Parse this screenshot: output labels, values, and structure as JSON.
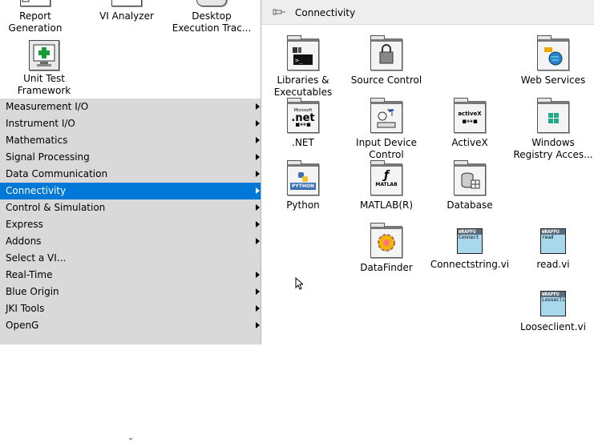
{
  "left_panel": {
    "top_tiles": [
      {
        "label": "Report\nGeneration",
        "icon": "report-generation-icon"
      },
      {
        "label": "VI Analyzer",
        "icon": "vi-analyzer-icon"
      },
      {
        "label": "Desktop\nExecution Trac...",
        "icon": "desktop-execution-trace-icon"
      },
      {
        "label": "Unit Test\nFramework",
        "icon": "unit-test-framework-icon"
      }
    ],
    "menu_items": [
      {
        "label": "Measurement I/O",
        "submenu": true
      },
      {
        "label": "Instrument I/O",
        "submenu": true
      },
      {
        "label": "Mathematics",
        "submenu": true
      },
      {
        "label": "Signal Processing",
        "submenu": true
      },
      {
        "label": "Data Communication",
        "submenu": true
      },
      {
        "label": "Connectivity",
        "submenu": true,
        "selected": true
      },
      {
        "label": "Control & Simulation",
        "submenu": true
      },
      {
        "label": "Express",
        "submenu": true
      },
      {
        "label": "Addons",
        "submenu": true
      },
      {
        "label": "Select a VI...",
        "submenu": false
      },
      {
        "label": "Real-Time",
        "submenu": true
      },
      {
        "label": "Blue Origin",
        "submenu": true
      },
      {
        "label": "JKI Tools",
        "submenu": true
      },
      {
        "label": "OpenG",
        "submenu": true
      }
    ],
    "scroll_indicator": "⌄"
  },
  "sub_palette": {
    "title": "Connectivity",
    "pin_icon": "thumbtack-icon",
    "items": [
      {
        "label": "Libraries &\nExecutables",
        "icon": "libraries-executables-icon"
      },
      {
        "label": "Source Control",
        "icon": "source-control-icon"
      },
      {
        "label": "Web Services",
        "icon": "web-services-icon"
      },
      {
        "label": ".NET",
        "icon": "dotnet-icon",
        "glyph_top": ".net",
        "glyph_small": "Microsoft"
      },
      {
        "label": "Input Device\nControl",
        "icon": "input-device-control-icon"
      },
      {
        "label": "ActiveX",
        "icon": "activex-icon",
        "glyph_top": "activeX"
      },
      {
        "label": "Windows\nRegistry Acces...",
        "icon": "windows-registry-icon"
      },
      {
        "label": "Python",
        "icon": "python-icon",
        "glyph_top": "PYTHON"
      },
      {
        "label": "MATLAB(R)",
        "icon": "matlab-icon",
        "glyph_top": "MATLAB"
      },
      {
        "label": "Database",
        "icon": "database-icon"
      },
      {
        "label": "DataFinder",
        "icon": "datafinder-icon"
      },
      {
        "label": "Connectstring.vi",
        "icon": "connectstring-vi-icon",
        "band": "WRAPFU",
        "sub": "Connect"
      },
      {
        "label": "read.vi",
        "icon": "read-vi-icon",
        "band": "WRAPFU",
        "sub": "read"
      },
      {
        "label": "Looseclient.vi",
        "icon": "looseclient-vi-icon",
        "band": "WRAPFU",
        "sub": "Looseclit"
      }
    ]
  },
  "colors": {
    "selected": "#0078d7",
    "menu_bg": "#d9d9d9",
    "header_bg": "#eeeeee",
    "vi_icon_bg": "#a8d8ec"
  }
}
